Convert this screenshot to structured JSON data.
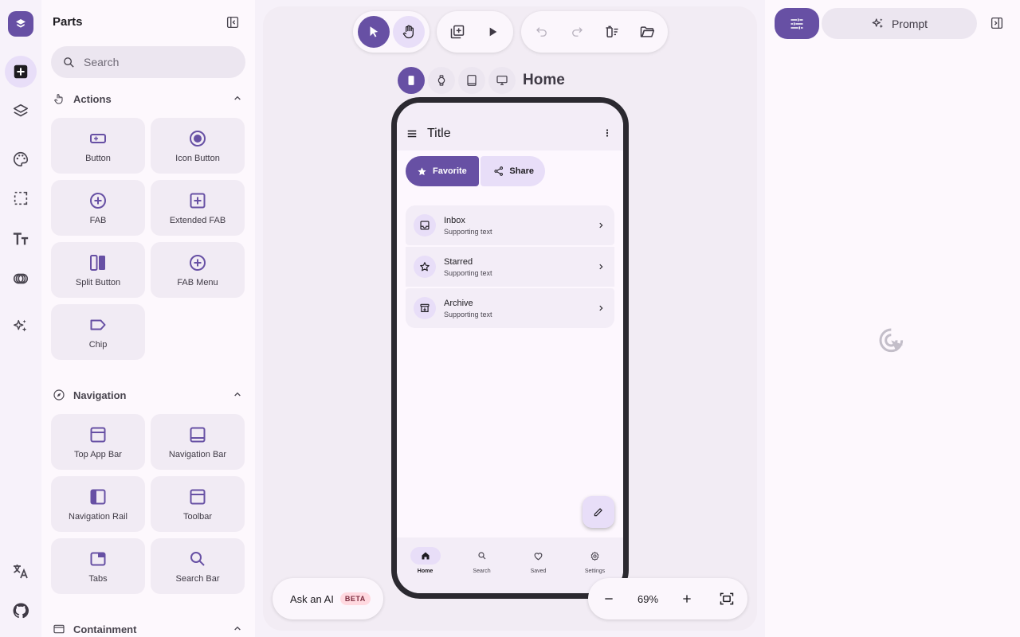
{
  "rail": {
    "items": [
      "add-icon",
      "layers-icon",
      "palette-icon",
      "select-icon",
      "text-icon",
      "components-icon",
      "ai-sparkle-icon",
      "translate-icon",
      "github-icon"
    ]
  },
  "parts": {
    "title": "Parts",
    "search_placeholder": "Search",
    "sections": [
      {
        "label": "Actions",
        "items": [
          {
            "label": "Button",
            "icon": "button-icon"
          },
          {
            "label": "Icon Button",
            "icon": "radio-icon"
          },
          {
            "label": "FAB",
            "icon": "add-circle-icon"
          },
          {
            "label": "Extended FAB",
            "icon": "add-box-icon"
          },
          {
            "label": "Split Button",
            "icon": "split-icon"
          },
          {
            "label": "FAB Menu",
            "icon": "add-circle-icon"
          },
          {
            "label": "Chip",
            "icon": "label-icon"
          }
        ]
      },
      {
        "label": "Navigation",
        "items": [
          {
            "label": "Top App Bar",
            "icon": "top-bar-icon"
          },
          {
            "label": "Navigation Bar",
            "icon": "bottom-bar-icon"
          },
          {
            "label": "Navigation Rail",
            "icon": "rail-icon"
          },
          {
            "label": "Toolbar",
            "icon": "toolbar-icon"
          },
          {
            "label": "Tabs",
            "icon": "tabs-icon"
          },
          {
            "label": "Search Bar",
            "icon": "search-icon"
          }
        ]
      },
      {
        "label": "Containment",
        "items": []
      }
    ]
  },
  "canvas": {
    "screen_name": "Home",
    "zoom": "69%",
    "ask_ai_label": "Ask an AI",
    "beta_label": "BETA"
  },
  "phone": {
    "appbar_title": "Title",
    "favorite_label": "Favorite",
    "share_label": "Share",
    "list": [
      {
        "title": "Inbox",
        "support": "Supporting text",
        "icon": "inbox-icon"
      },
      {
        "title": "Starred",
        "support": "Supporting text",
        "icon": "star-outline-icon"
      },
      {
        "title": "Archive",
        "support": "Supporting text",
        "icon": "archive-icon"
      }
    ],
    "nav": [
      {
        "label": "Home",
        "icon": "home-icon",
        "active": true
      },
      {
        "label": "Search",
        "icon": "search-icon",
        "active": false
      },
      {
        "label": "Saved",
        "icon": "heart-icon",
        "active": false
      },
      {
        "label": "Settings",
        "icon": "settings-icon",
        "active": false
      }
    ]
  },
  "right_panel": {
    "prompt_label": "Prompt"
  },
  "colors": {
    "primary": "#6750a4",
    "secondary_container": "#e8def8",
    "surface": "#fdf8fd"
  }
}
